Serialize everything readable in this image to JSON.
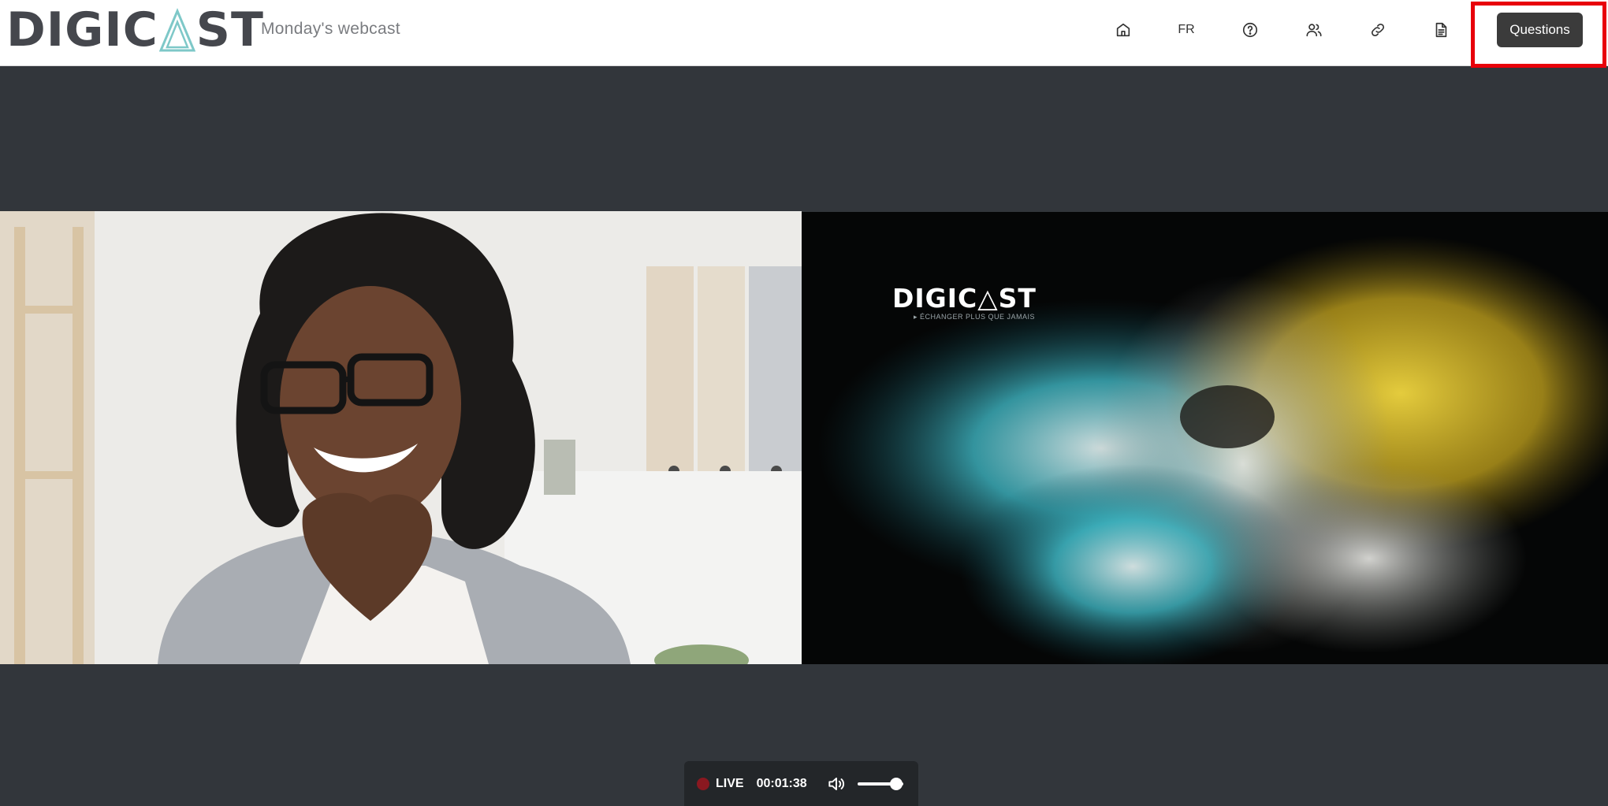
{
  "header": {
    "logo_text_left": "DIGIC",
    "logo_text_right": "ST",
    "webcast_title": "Monday's webcast",
    "nav": {
      "home_icon": "home-icon",
      "language_label": "FR",
      "help_icon": "help-circle-icon",
      "participants_icon": "users-icon",
      "link_icon": "link-icon",
      "document_icon": "document-icon"
    },
    "questions_label": "Questions"
  },
  "slide": {
    "logo_text": "DIGIC△ST",
    "tagline": "▸ ÉCHANGER PLUS QUE JAMAIS"
  },
  "player": {
    "live_label": "LIVE",
    "timecode": "00:01:38",
    "volume_level": 0.85
  },
  "colors": {
    "accent_logo": "#7ec8c8",
    "header_text": "#45474d",
    "highlight": "#e8000a",
    "stage_bg": "#32363b",
    "live_dot": "#8a1820"
  }
}
